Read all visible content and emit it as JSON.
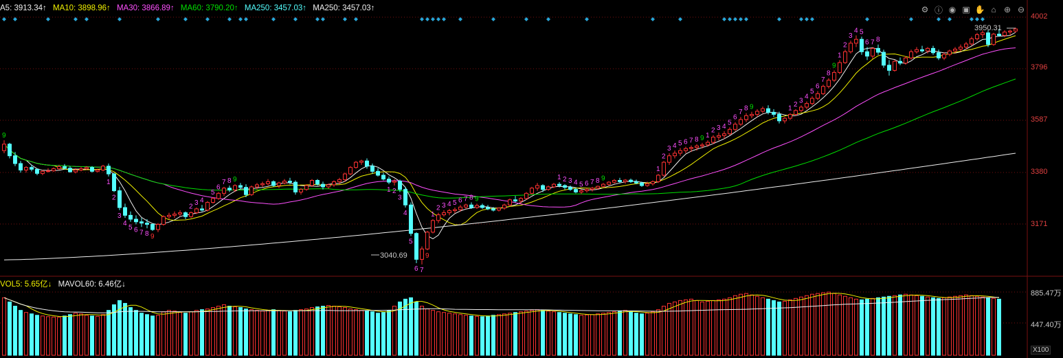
{
  "legend": {
    "ma5": "A5: 3913.34↑",
    "ma10": "MA10: 3898.96↑",
    "ma30": "MA30: 3866.89↑",
    "ma60": "MA60: 3790.20↑",
    "ma250": "MA250: 3457.03↑",
    "ma250b": "MA250: 3457.03↑"
  },
  "vol_legend": {
    "vol5": "VOL5: 5.65亿↓",
    "mavol60": "MAVOL60: 6.46亿↓"
  },
  "price_axis": [
    "4002",
    "3796",
    "3587",
    "3380",
    "3171"
  ],
  "vol_axis": [
    "885.47万",
    "447.40万"
  ],
  "vol_unit": "X100",
  "annotations": {
    "high": "3950.31",
    "low": "3040.69"
  },
  "toolbar": [
    "settings-icon",
    "info-icon",
    "eye-icon",
    "briefcase-icon",
    "hand-icon",
    "home-icon",
    "zoom-in-icon",
    "zoom-out-icon"
  ],
  "colors": {
    "up": "#ff3232",
    "down": "#54ffff",
    "ma5": "#f0f0f0",
    "ma10": "#f0f000",
    "ma30": "#ff50ff",
    "ma60": "#00e000",
    "ma250": "#54ffff",
    "grid": "#7a1010",
    "td_up": "#ff50ff",
    "td9_green": "#00e000",
    "td9_red": "#ff3232"
  },
  "chart_data": {
    "type": "candlestick",
    "price_ylim": [
      3000,
      4030
    ],
    "candles": [
      [
        3480,
        3520,
        3470,
        3505
      ],
      [
        3505,
        3510,
        3450,
        3460
      ],
      [
        3460,
        3475,
        3420,
        3430
      ],
      [
        3430,
        3440,
        3395,
        3405
      ],
      [
        3405,
        3420,
        3395,
        3415
      ],
      [
        3415,
        3425,
        3400,
        3408
      ],
      [
        3408,
        3410,
        3385,
        3392
      ],
      [
        3392,
        3405,
        3385,
        3400
      ],
      [
        3400,
        3412,
        3395,
        3402
      ],
      [
        3402,
        3415,
        3398,
        3410
      ],
      [
        3410,
        3425,
        3405,
        3418
      ],
      [
        3418,
        3428,
        3408,
        3412
      ],
      [
        3412,
        3420,
        3395,
        3398
      ],
      [
        3398,
        3412,
        3392,
        3405
      ],
      [
        3405,
        3418,
        3400,
        3410
      ],
      [
        3410,
        3420,
        3405,
        3415
      ],
      [
        3415,
        3420,
        3395,
        3400
      ],
      [
        3400,
        3410,
        3395,
        3405
      ],
      [
        3405,
        3425,
        3400,
        3420
      ],
      [
        3420,
        3430,
        3380,
        3390
      ],
      [
        3390,
        3395,
        3320,
        3325
      ],
      [
        3325,
        3340,
        3250,
        3260
      ],
      [
        3260,
        3275,
        3220,
        3230
      ],
      [
        3230,
        3245,
        3205,
        3215
      ],
      [
        3215,
        3230,
        3195,
        3205
      ],
      [
        3205,
        3220,
        3185,
        3200
      ],
      [
        3200,
        3215,
        3180,
        3195
      ],
      [
        3195,
        3200,
        3170,
        3175
      ],
      [
        3175,
        3200,
        3165,
        3195
      ],
      [
        3195,
        3230,
        3190,
        3225
      ],
      [
        3225,
        3240,
        3215,
        3230
      ],
      [
        3230,
        3245,
        3220,
        3235
      ],
      [
        3235,
        3250,
        3225,
        3240
      ],
      [
        3240,
        3245,
        3215,
        3225
      ],
      [
        3225,
        3245,
        3220,
        3240
      ],
      [
        3240,
        3260,
        3235,
        3255
      ],
      [
        3255,
        3270,
        3245,
        3250
      ],
      [
        3250,
        3285,
        3245,
        3280
      ],
      [
        3280,
        3300,
        3275,
        3295
      ],
      [
        3295,
        3320,
        3290,
        3315
      ],
      [
        3315,
        3340,
        3305,
        3335
      ],
      [
        3335,
        3345,
        3320,
        3328
      ],
      [
        3328,
        3350,
        3320,
        3345
      ],
      [
        3345,
        3355,
        3330,
        3338
      ],
      [
        3338,
        3350,
        3300,
        3310
      ],
      [
        3310,
        3345,
        3305,
        3340
      ],
      [
        3340,
        3355,
        3330,
        3348
      ],
      [
        3348,
        3360,
        3340,
        3352
      ],
      [
        3352,
        3370,
        3345,
        3360
      ],
      [
        3360,
        3365,
        3340,
        3345
      ],
      [
        3345,
        3360,
        3335,
        3355
      ],
      [
        3355,
        3370,
        3350,
        3362
      ],
      [
        3362,
        3375,
        3350,
        3358
      ],
      [
        3358,
        3365,
        3310,
        3320
      ],
      [
        3320,
        3335,
        3310,
        3330
      ],
      [
        3330,
        3350,
        3325,
        3345
      ],
      [
        3345,
        3370,
        3340,
        3365
      ],
      [
        3365,
        3370,
        3345,
        3350
      ],
      [
        3350,
        3360,
        3330,
        3340
      ],
      [
        3340,
        3352,
        3332,
        3348
      ],
      [
        3348,
        3365,
        3340,
        3360
      ],
      [
        3360,
        3375,
        3350,
        3368
      ],
      [
        3368,
        3395,
        3360,
        3390
      ],
      [
        3390,
        3420,
        3385,
        3415
      ],
      [
        3415,
        3440,
        3410,
        3435
      ],
      [
        3435,
        3445,
        3425,
        3440
      ],
      [
        3440,
        3450,
        3410,
        3420
      ],
      [
        3420,
        3430,
        3390,
        3400
      ],
      [
        3400,
        3412,
        3380,
        3385
      ],
      [
        3385,
        3395,
        3365,
        3370
      ],
      [
        3370,
        3380,
        3350,
        3358
      ],
      [
        3358,
        3370,
        3345,
        3362
      ],
      [
        3362,
        3368,
        3320,
        3330
      ],
      [
        3330,
        3340,
        3260,
        3270
      ],
      [
        3270,
        3280,
        3150,
        3160
      ],
      [
        3160,
        3165,
        3045,
        3060
      ],
      [
        3060,
        3110,
        3040,
        3100
      ],
      [
        3100,
        3170,
        3095,
        3165
      ],
      [
        3165,
        3215,
        3160,
        3210
      ],
      [
        3210,
        3240,
        3200,
        3232
      ],
      [
        3232,
        3250,
        3225,
        3240
      ],
      [
        3240,
        3255,
        3230,
        3248
      ],
      [
        3248,
        3260,
        3238,
        3252
      ],
      [
        3252,
        3270,
        3245,
        3262
      ],
      [
        3262,
        3275,
        3255,
        3270
      ],
      [
        3270,
        3280,
        3255,
        3260
      ],
      [
        3260,
        3275,
        3255,
        3268
      ],
      [
        3268,
        3275,
        3255,
        3260
      ],
      [
        3260,
        3270,
        3250,
        3255
      ],
      [
        3255,
        3262,
        3245,
        3250
      ],
      [
        3250,
        3260,
        3245,
        3258
      ],
      [
        3258,
        3275,
        3252,
        3270
      ],
      [
        3270,
        3295,
        3265,
        3290
      ],
      [
        3290,
        3305,
        3280,
        3285
      ],
      [
        3285,
        3300,
        3275,
        3295
      ],
      [
        3295,
        3320,
        3290,
        3315
      ],
      [
        3315,
        3340,
        3310,
        3335
      ],
      [
        3335,
        3355,
        3325,
        3345
      ],
      [
        3345,
        3350,
        3320,
        3330
      ],
      [
        3330,
        3345,
        3325,
        3340
      ],
      [
        3340,
        3355,
        3335,
        3350
      ],
      [
        3350,
        3358,
        3338,
        3345
      ],
      [
        3345,
        3350,
        3330,
        3338
      ],
      [
        3338,
        3345,
        3325,
        3330
      ],
      [
        3330,
        3338,
        3315,
        3320
      ],
      [
        3320,
        3330,
        3312,
        3325
      ],
      [
        3325,
        3335,
        3318,
        3330
      ],
      [
        3330,
        3340,
        3322,
        3335
      ],
      [
        3335,
        3345,
        3330,
        3342
      ],
      [
        3342,
        3355,
        3338,
        3350
      ],
      [
        3350,
        3362,
        3345,
        3358
      ],
      [
        3358,
        3370,
        3352,
        3365
      ],
      [
        3365,
        3375,
        3355,
        3360
      ],
      [
        3360,
        3370,
        3352,
        3366
      ],
      [
        3366,
        3372,
        3355,
        3360
      ],
      [
        3360,
        3368,
        3350,
        3355
      ],
      [
        3355,
        3360,
        3340,
        3345
      ],
      [
        3345,
        3360,
        3340,
        3352
      ],
      [
        3352,
        3365,
        3345,
        3360
      ],
      [
        3360,
        3390,
        3355,
        3385
      ],
      [
        3385,
        3440,
        3380,
        3435
      ],
      [
        3435,
        3470,
        3425,
        3460
      ],
      [
        3460,
        3480,
        3450,
        3470
      ],
      [
        3470,
        3490,
        3460,
        3480
      ],
      [
        3480,
        3495,
        3470,
        3488
      ],
      [
        3488,
        3500,
        3475,
        3492
      ],
      [
        3492,
        3505,
        3480,
        3498
      ],
      [
        3498,
        3510,
        3488,
        3502
      ],
      [
        3502,
        3520,
        3495,
        3512
      ],
      [
        3512,
        3540,
        3505,
        3532
      ],
      [
        3532,
        3550,
        3520,
        3538
      ],
      [
        3538,
        3555,
        3525,
        3545
      ],
      [
        3545,
        3570,
        3540,
        3562
      ],
      [
        3562,
        3590,
        3555,
        3582
      ],
      [
        3582,
        3610,
        3575,
        3600
      ],
      [
        3600,
        3625,
        3590,
        3615
      ],
      [
        3615,
        3630,
        3605,
        3620
      ],
      [
        3620,
        3640,
        3610,
        3632
      ],
      [
        3632,
        3650,
        3625,
        3642
      ],
      [
        3642,
        3655,
        3620,
        3628
      ],
      [
        3628,
        3640,
        3610,
        3620
      ],
      [
        3620,
        3630,
        3585,
        3595
      ],
      [
        3595,
        3610,
        3585,
        3605
      ],
      [
        3605,
        3625,
        3598,
        3620
      ],
      [
        3620,
        3640,
        3615,
        3635
      ],
      [
        3635,
        3655,
        3628,
        3648
      ],
      [
        3648,
        3670,
        3640,
        3662
      ],
      [
        3662,
        3690,
        3655,
        3682
      ],
      [
        3682,
        3710,
        3675,
        3700
      ],
      [
        3700,
        3735,
        3695,
        3728
      ],
      [
        3728,
        3760,
        3720,
        3752
      ],
      [
        3752,
        3790,
        3745,
        3782
      ],
      [
        3782,
        3830,
        3775,
        3820
      ],
      [
        3820,
        3870,
        3815,
        3862
      ],
      [
        3862,
        3905,
        3855,
        3895
      ],
      [
        3895,
        3925,
        3880,
        3910
      ],
      [
        3910,
        3920,
        3850,
        3862
      ],
      [
        3862,
        3880,
        3830,
        3845
      ],
      [
        3845,
        3880,
        3835,
        3875
      ],
      [
        3875,
        3890,
        3850,
        3860
      ],
      [
        3860,
        3870,
        3800,
        3810
      ],
      [
        3810,
        3830,
        3770,
        3790
      ],
      [
        3790,
        3830,
        3785,
        3825
      ],
      [
        3825,
        3840,
        3810,
        3818
      ],
      [
        3818,
        3845,
        3812,
        3838
      ],
      [
        3838,
        3870,
        3832,
        3862
      ],
      [
        3862,
        3880,
        3855,
        3870
      ],
      [
        3870,
        3885,
        3858,
        3865
      ],
      [
        3865,
        3880,
        3855,
        3875
      ],
      [
        3875,
        3885,
        3850,
        3858
      ],
      [
        3858,
        3870,
        3830,
        3838
      ],
      [
        3838,
        3860,
        3830,
        3852
      ],
      [
        3852,
        3870,
        3845,
        3865
      ],
      [
        3865,
        3880,
        3855,
        3872
      ],
      [
        3872,
        3890,
        3862,
        3880
      ],
      [
        3880,
        3900,
        3870,
        3892
      ],
      [
        3892,
        3920,
        3885,
        3912
      ],
      [
        3912,
        3935,
        3905,
        3928
      ],
      [
        3928,
        3945,
        3915,
        3935
      ],
      [
        3935,
        3945,
        3880,
        3890
      ],
      [
        3890,
        3935,
        3885,
        3930
      ],
      [
        3930,
        3950,
        3920,
        3925
      ],
      [
        3925,
        3945,
        3918,
        3938
      ],
      [
        3938,
        3948,
        3925,
        3942
      ],
      [
        3942,
        3955,
        3935,
        3950
      ]
    ],
    "volume_ylim": [
      0,
      950
    ],
    "volumes": [
      820,
      760,
      700,
      640,
      610,
      590,
      570,
      560,
      550,
      545,
      540,
      560,
      580,
      600,
      590,
      570,
      560,
      555,
      580,
      640,
      720,
      780,
      740,
      680,
      640,
      600,
      580,
      560,
      570,
      620,
      640,
      630,
      610,
      600,
      620,
      640,
      650,
      660,
      680,
      700,
      720,
      700,
      690,
      680,
      660,
      650,
      640,
      630,
      640,
      650,
      640,
      630,
      620,
      640,
      650,
      660,
      680,
      690,
      700,
      710,
      700,
      690,
      680,
      660,
      650,
      640,
      630,
      620,
      600,
      610,
      640,
      700,
      760,
      800,
      820,
      760,
      700,
      660,
      640,
      620,
      610,
      600,
      590,
      580,
      570,
      560,
      555,
      550,
      560,
      570,
      580,
      590,
      600,
      610,
      620,
      630,
      640,
      650,
      640,
      630,
      620,
      610,
      600,
      590,
      580,
      570,
      575,
      580,
      590,
      600,
      610,
      620,
      630,
      640,
      620,
      600,
      590,
      600,
      620,
      650,
      700,
      740,
      760,
      780,
      790,
      800,
      780,
      760,
      770,
      780,
      790,
      800,
      820,
      850,
      870,
      880,
      860,
      840,
      820,
      800,
      780,
      760,
      770,
      790,
      810,
      830,
      850,
      870,
      880,
      890,
      900,
      880,
      860,
      840,
      820,
      800,
      790,
      800,
      810,
      820,
      830,
      840,
      850,
      860,
      870,
      860,
      850,
      840,
      830,
      820,
      810,
      820,
      830,
      840,
      850,
      860,
      850,
      840,
      830,
      820,
      810,
      800
    ],
    "vol_up_flags_seed": 17
  }
}
